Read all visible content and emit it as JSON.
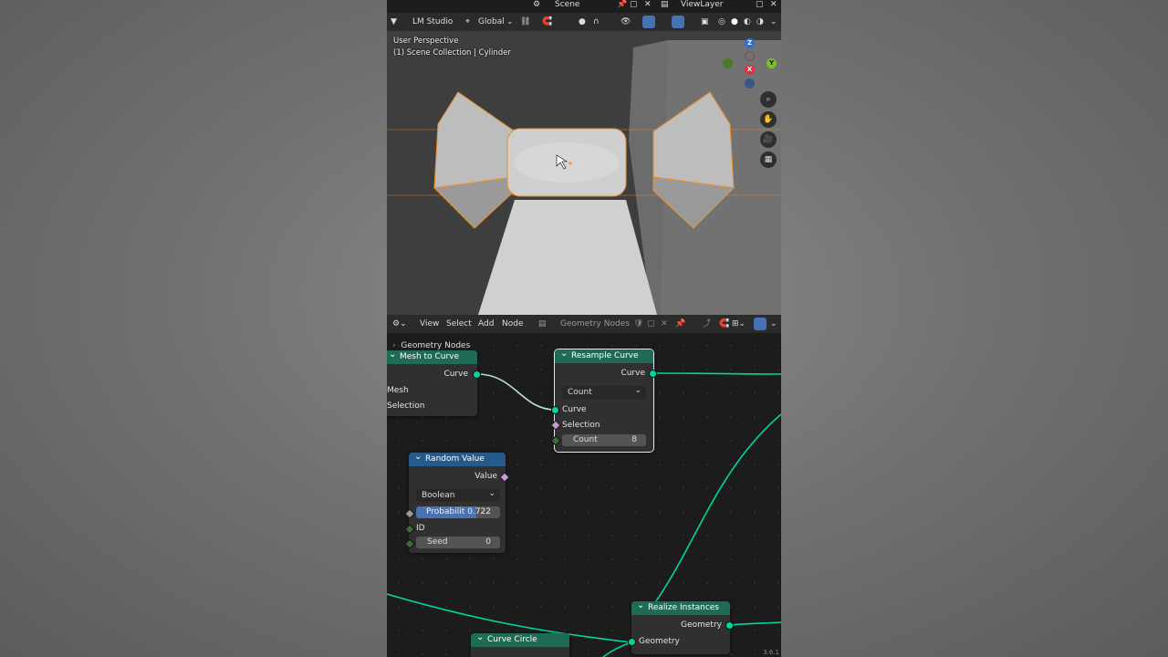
{
  "topbar": {
    "scene": "Scene",
    "view_layer": "ViewLayer"
  },
  "viewport_header": {
    "workspace": "LM Studio",
    "orientation": "Global"
  },
  "viewport_overlay": {
    "perspective": "User Perspective",
    "collection": "(1) Scene Collection | Cylinder"
  },
  "gizmo": {
    "z": "Z",
    "x": "X",
    "y": "Y"
  },
  "node_editor_header": {
    "menu": [
      "View",
      "Select",
      "Add",
      "Node"
    ],
    "tree_name": "Geometry Nodes"
  },
  "breadcrumb": "Geometry Nodes",
  "nodes": {
    "mesh_to_curve": {
      "title": "Mesh to Curve",
      "out_curve": "Curve",
      "in_mesh": "Mesh",
      "in_selection": "Selection"
    },
    "resample_curve": {
      "title": "Resample Curve",
      "out_curve": "Curve",
      "mode": "Count",
      "in_curve": "Curve",
      "in_selection": "Selection",
      "count_label": "Count",
      "count_value": "8"
    },
    "random_value": {
      "title": "Random Value",
      "out_value": "Value",
      "type": "Boolean",
      "prob_label": "Probabilit",
      "prob_value": "0.722",
      "prob_fraction": 0.722,
      "id_label": "ID",
      "seed_label": "Seed",
      "seed_value": "0"
    },
    "realize_instances": {
      "title": "Realize Instances",
      "out_geometry": "Geometry",
      "in_geometry": "Geometry"
    },
    "curve_circle": {
      "title": "Curve Circle"
    }
  },
  "version": "3.6.1",
  "colors": {
    "geometry_socket": "#00d6a3",
    "node_header_green": "#1f6b55",
    "node_header_blue": "#245b8a",
    "selection_orange": "#e8902a",
    "accent_blue": "#4772b3"
  }
}
